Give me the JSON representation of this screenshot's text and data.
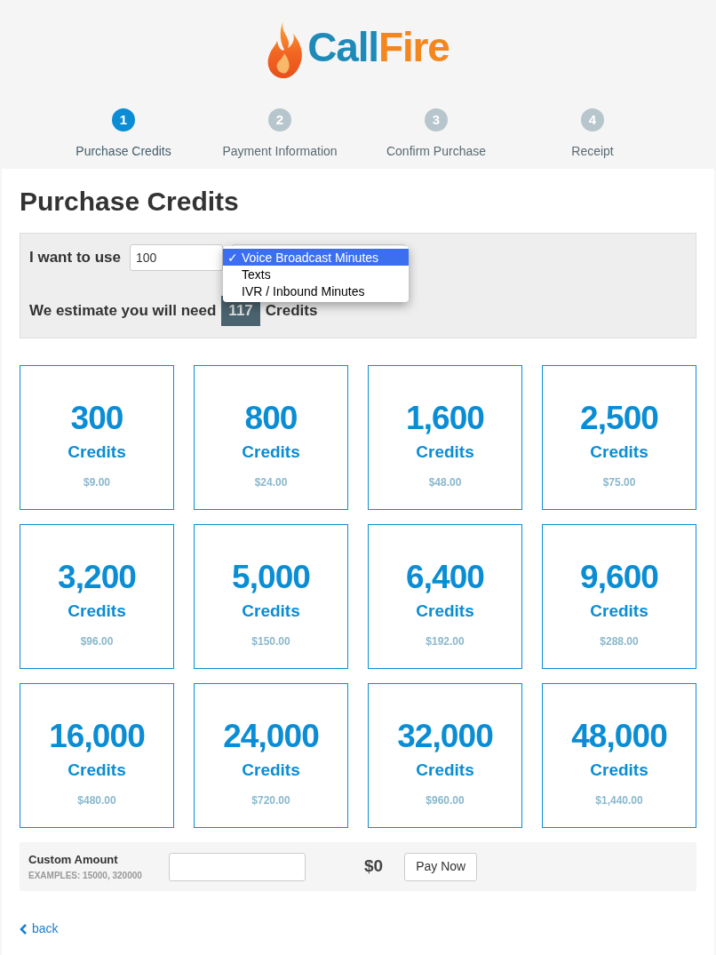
{
  "logo": {
    "part_1": "Call",
    "part_2": "Fire"
  },
  "steps": [
    {
      "number": "1",
      "label": "Purchase Credits",
      "selected": true
    },
    {
      "number": "2",
      "label": "Payment Information",
      "selected": false
    },
    {
      "number": "3",
      "label": "Confirm Purchase",
      "selected": false
    },
    {
      "number": "4",
      "label": "Receipt",
      "selected": false
    }
  ],
  "title": "Purchase Credits",
  "estimator": {
    "use_label": "I want to use",
    "amount": "100",
    "estimate_label": "We estimate you will need",
    "estimate_value": "117",
    "estimate_unit": "Credits",
    "dropdown": [
      {
        "label": "Voice Broadcast Minutes",
        "selected": true
      },
      {
        "label": "Texts",
        "selected": false
      },
      {
        "label": "IVR / Inbound Minutes",
        "selected": false
      }
    ],
    "check_mark": "✓"
  },
  "packages": [
    {
      "credits": "300",
      "unit": "Credits",
      "price": "$9.00"
    },
    {
      "credits": "800",
      "unit": "Credits",
      "price": "$24.00"
    },
    {
      "credits": "1,600",
      "unit": "Credits",
      "price": "$48.00"
    },
    {
      "credits": "2,500",
      "unit": "Credits",
      "price": "$75.00"
    },
    {
      "credits": "3,200",
      "unit": "Credits",
      "price": "$96.00"
    },
    {
      "credits": "5,000",
      "unit": "Credits",
      "price": "$150.00"
    },
    {
      "credits": "6,400",
      "unit": "Credits",
      "price": "$192.00"
    },
    {
      "credits": "9,600",
      "unit": "Credits",
      "price": "$288.00"
    },
    {
      "credits": "16,000",
      "unit": "Credits",
      "price": "$480.00"
    },
    {
      "credits": "24,000",
      "unit": "Credits",
      "price": "$720.00"
    },
    {
      "credits": "32,000",
      "unit": "Credits",
      "price": "$960.00"
    },
    {
      "credits": "48,000",
      "unit": "Credits",
      "price": "$1,440.00"
    }
  ],
  "custom": {
    "label": "Custom Amount",
    "hint": "EXAMPLES: 15000, 320000",
    "total": "$0",
    "button": "Pay Now"
  },
  "back_link": "back"
}
